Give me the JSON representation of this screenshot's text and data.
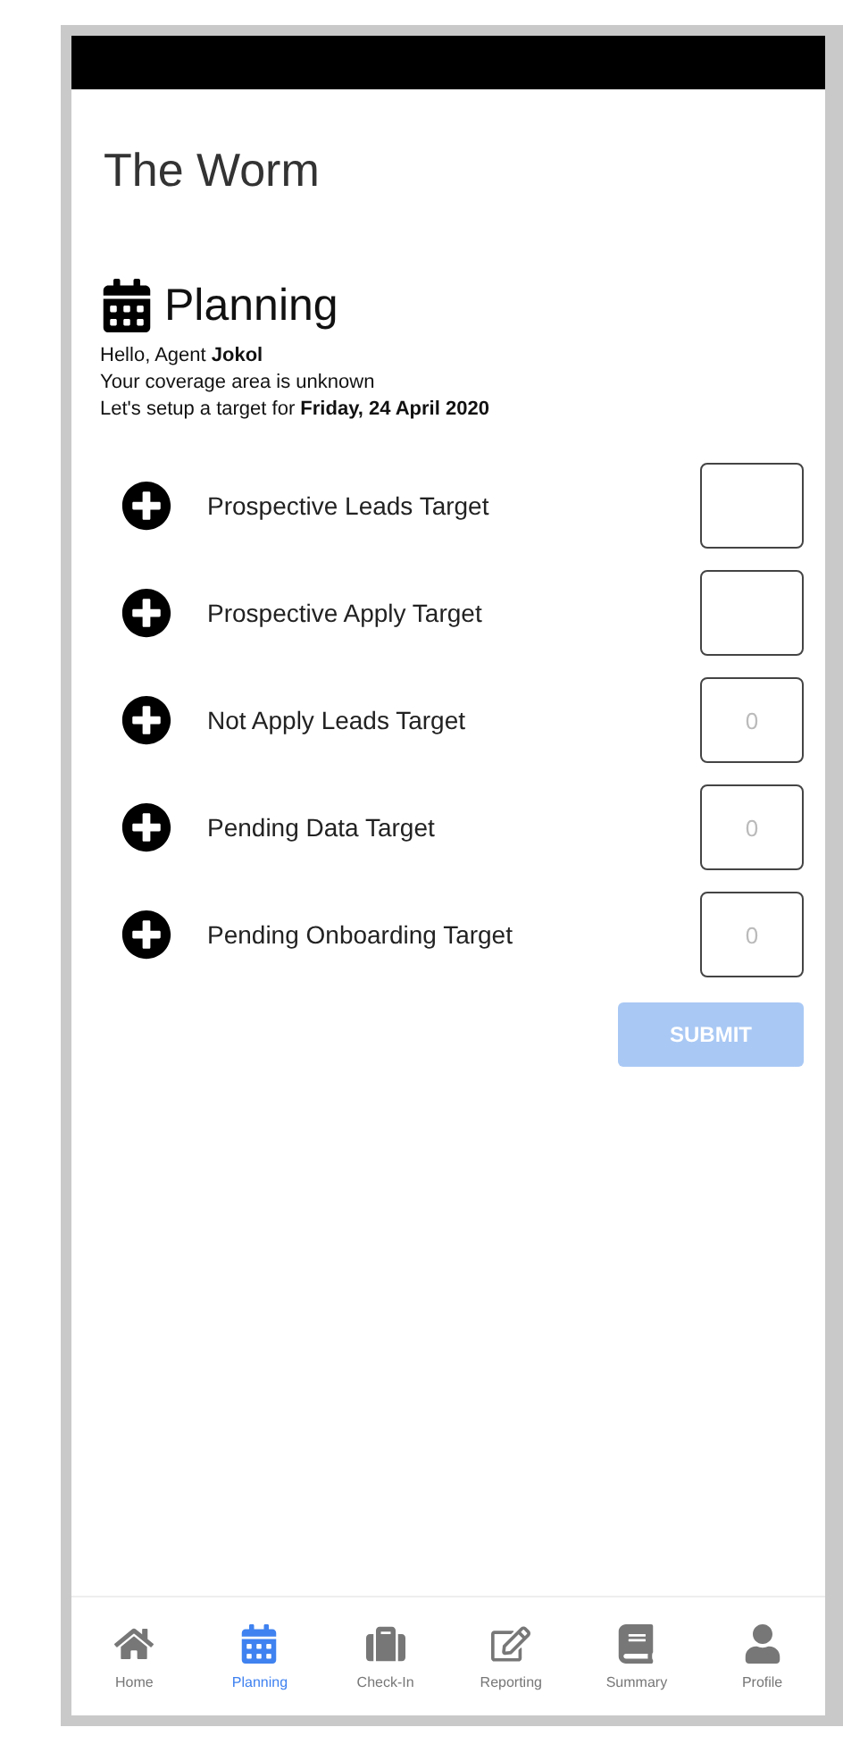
{
  "app_title": "The Worm",
  "header": {
    "title": "Planning",
    "lines": [
      "Hello, Agent **Jokol**",
      "Your coverage area is unknown",
      "Let's setup a target for **Friday, 24 April 2020**"
    ]
  },
  "targets": [
    {
      "label": "Prospective Leads Target"
    },
    {
      "label": "Prospective Apply Target"
    },
    {
      "label": "Not Apply Leads Target",
      "placeholder": "0"
    },
    {
      "label": "Pending Data Target",
      "placeholder": "0"
    },
    {
      "label": "Pending Onboarding Target",
      "placeholder": "0"
    }
  ],
  "submit": {
    "label": "SUBMIT",
    "disabled": true
  },
  "nav": [
    {
      "kind": "home",
      "label": "Home",
      "selected": false
    },
    {
      "kind": "planning",
      "label": "Planning",
      "selected": true
    },
    {
      "kind": "checkin",
      "label": "Check-In",
      "selected": false
    },
    {
      "kind": "reporting",
      "label": "Reporting",
      "selected": false
    },
    {
      "kind": "summary",
      "label": "Summary",
      "selected": false
    },
    {
      "kind": "profile",
      "label": "Profile",
      "selected": false
    }
  ]
}
